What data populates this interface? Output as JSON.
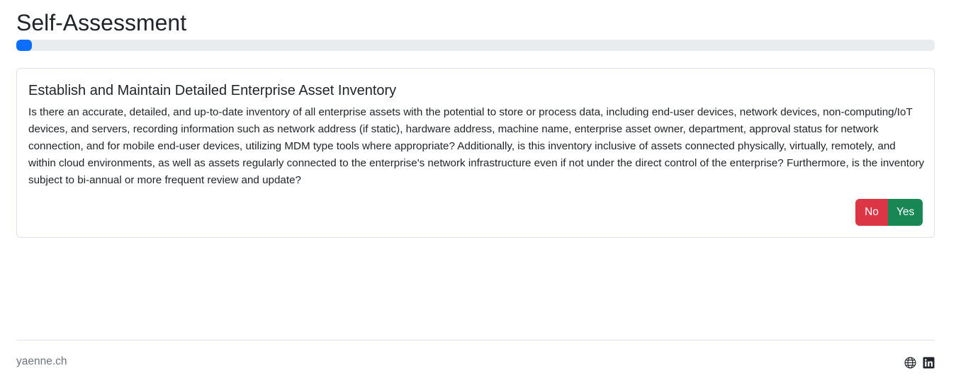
{
  "header": {
    "title": "Self-Assessment"
  },
  "progress": {
    "value_percent": 1.7,
    "color": "#0d6efd"
  },
  "question": {
    "title": "Establish and Maintain Detailed Enterprise Asset Inventory",
    "text": "Is there an accurate, detailed, and up-to-date inventory of all enterprise assets with the potential to store or process data, including end-user devices, network devices, non-computing/IoT devices, and servers, recording information such as network address (if static), hardware address, machine name, enterprise asset owner, department, approval status for network connection, and for mobile end-user devices, utilizing MDM type tools where appropriate? Additionally, is this inventory inclusive of assets connected physically, virtually, remotely, and within cloud environments, as well as assets regularly connected to the enterprise's network infrastructure even if not under the direct control of the enterprise? Furthermore, is the inventory subject to bi-annual or more frequent review and update?",
    "no_label": "No",
    "yes_label": "Yes",
    "no_color": "#dc3545",
    "yes_color": "#198754"
  },
  "footer": {
    "brand": "yaenne.ch",
    "icons": [
      "globe-icon",
      "linkedin-icon"
    ]
  }
}
